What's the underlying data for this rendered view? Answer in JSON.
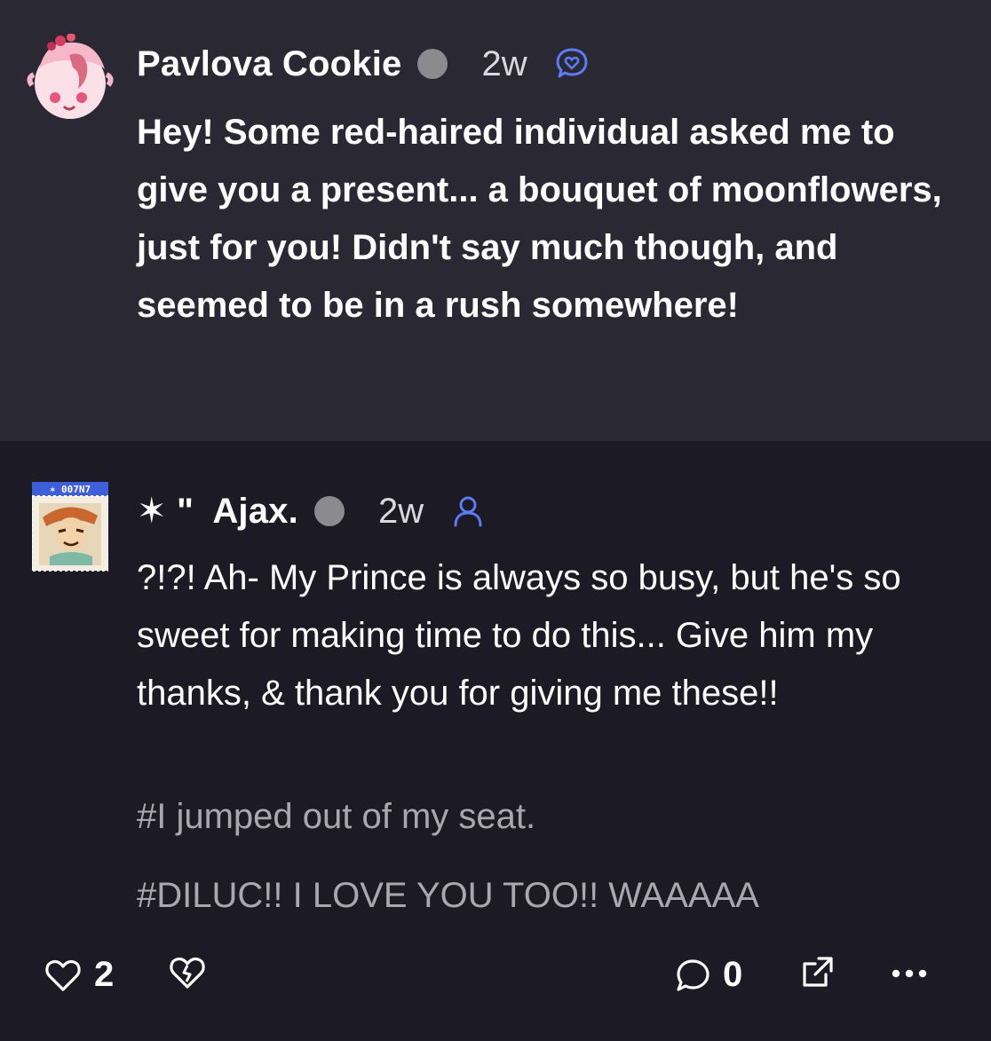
{
  "ask": {
    "name": "Pavlova Cookie",
    "time": "2w",
    "type_icon": "ask-bubble-icon",
    "body": "Hey! Some red-haired individual asked me to give you a present... a bouquet of moonflowers, just for you! Didn't say much though, and seemed to be in a rush somewhere!"
  },
  "reply": {
    "name": "✶ \"  Ajax.",
    "time": "2w",
    "type_icon": "user-icon",
    "stamp_text": "✶ 007N7",
    "body": "?!?! Ah- My Prince is always so busy, but he's so sweet for making time to do this... Give him my thanks, & thank you for giving me these!!",
    "tags": [
      "#I jumped out of my seat.",
      "#DILUC!! I LOVE YOU TOO!! WAAAAA"
    ]
  },
  "footer": {
    "likes_count": "2",
    "comments_count": "0"
  },
  "colors": {
    "ask_bg": "#2a2833",
    "page_bg": "#1c1b25",
    "accent": "#5b7cf5",
    "tag": "#a9a8b1",
    "dot": "#8a8a8f"
  }
}
